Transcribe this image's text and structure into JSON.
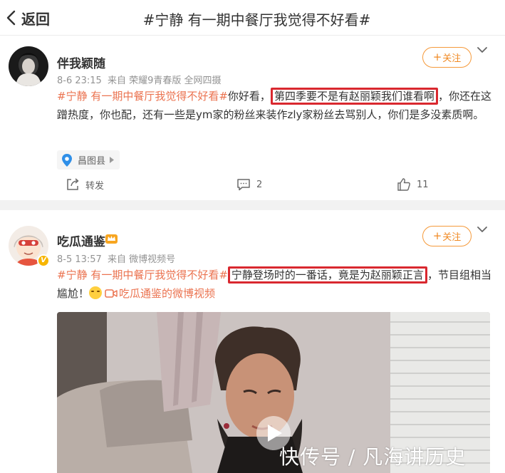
{
  "nav": {
    "back_label": "返回",
    "title": "#宁静 有一期中餐厅我觉得不好看#"
  },
  "posts": [
    {
      "username": "伴我颖随",
      "time": "8-6 23:15",
      "from": "来自 荣耀9青春版 全网四摄",
      "follow_label": "关注",
      "content": {
        "topic": "#宁静 有一期中餐厅我觉得不好看#",
        "text1": "你好看，",
        "highlight": "第四季要不是有赵丽颖我们谁看啊",
        "text2": "，你还在这蹭热度，你也配，还有一些是ym家的粉丝来装作zly家粉丝去骂别人，你们是多没素质啊。"
      },
      "location": "昌图县",
      "actions": {
        "repost_label": "转发",
        "comment_count": "2",
        "like_count": "11"
      }
    },
    {
      "username": "吃瓜通鉴",
      "time": "8-5 13:57",
      "from": "来自 微博视频号",
      "follow_label": "关注",
      "content": {
        "topic": "#宁静 有一期中餐厅我觉得不好看#",
        "highlight": "宁静登场时的一番话，竟是为赵丽颖正言",
        "text2": "，节目组相当尴尬！",
        "video_link": "吃瓜通鉴的微博视频"
      }
    }
  ],
  "watermark": "快传号 / 凡海讲历史",
  "colors": {
    "accent": "#eb7350",
    "follow": "#f08a24",
    "highlight_border": "#d9282f",
    "meta": "#939393"
  },
  "icons": [
    "back-arrow-icon",
    "chevron-down-icon",
    "location-pin-icon",
    "repost-icon",
    "comment-icon",
    "like-icon",
    "play-icon",
    "emoji-icon",
    "video-camera-icon"
  ]
}
